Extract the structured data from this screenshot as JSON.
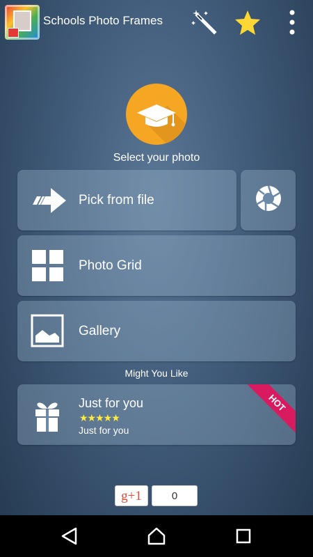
{
  "app": {
    "title": "Schools Photo Frames",
    "icons": [
      "app-logo-icon",
      "magic-wand-icon",
      "star-icon",
      "more-vert-icon"
    ],
    "accent_color": "#f5a623",
    "star_color": "#fdd835"
  },
  "main": {
    "select_label": "Select your photo",
    "pick_from_file_label": "Pick from file",
    "photo_grid_label": "Photo Grid",
    "gallery_label": "Gallery",
    "might_you_like_label": "Might You Like"
  },
  "promo": {
    "title": "Just for you",
    "stars": "★★★★★",
    "subtitle": "Just for you",
    "badge": "HOT",
    "badge_color": "#d81b60"
  },
  "social": {
    "gplus_label": "g+1",
    "count": "0"
  },
  "navbar": {
    "icons": [
      "back-icon",
      "home-icon",
      "recent-apps-icon"
    ]
  }
}
